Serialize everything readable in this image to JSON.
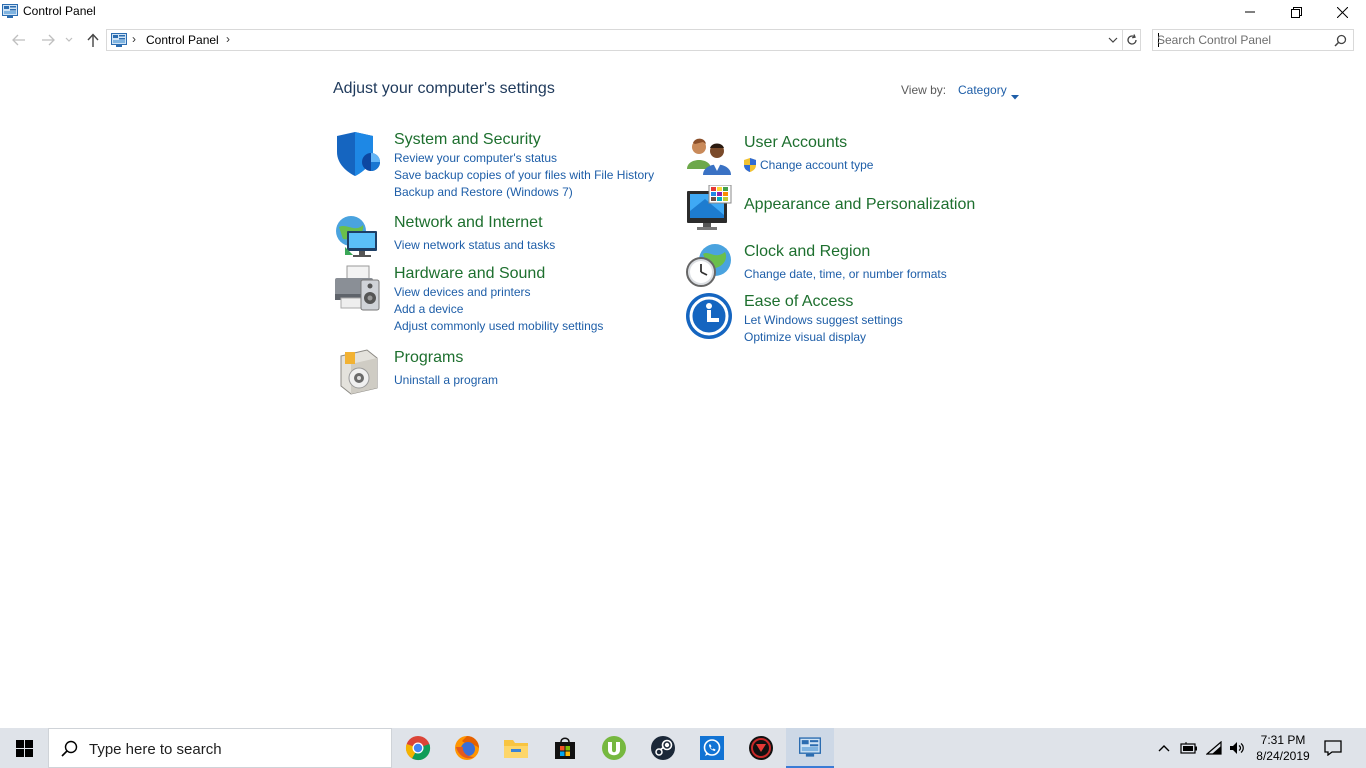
{
  "window": {
    "title": "Control Panel"
  },
  "address": {
    "crumb": "Control Panel",
    "search_placeholder": "Search Control Panel"
  },
  "content": {
    "heading": "Adjust your computer's settings",
    "view_by_label": "View by:",
    "view_by_value": "Category",
    "left_categories": [
      {
        "title": "System and Security",
        "icon": "shield-icon",
        "links": [
          "Review your computer's status",
          "Save backup copies of your files with File History",
          "Backup and Restore (Windows 7)"
        ]
      },
      {
        "title": "Network and Internet",
        "icon": "network-icon",
        "links": [
          "View network status and tasks"
        ]
      },
      {
        "title": "Hardware and Sound",
        "icon": "printer-speaker-icon",
        "links": [
          "View devices and printers",
          "Add a device",
          "Adjust commonly used mobility settings"
        ]
      },
      {
        "title": "Programs",
        "icon": "programs-disc-icon",
        "links": [
          "Uninstall a program"
        ]
      }
    ],
    "right_categories": [
      {
        "title": "User Accounts",
        "icon": "users-icon",
        "links": [
          "Change account type"
        ]
      },
      {
        "title": "Appearance and Personalization",
        "icon": "monitor-palette-icon",
        "links": []
      },
      {
        "title": "Clock and Region",
        "icon": "clock-globe-icon",
        "links": [
          "Change date, time, or number formats"
        ]
      },
      {
        "title": "Ease of Access",
        "icon": "ease-of-access-icon",
        "links": [
          "Let Windows suggest settings",
          "Optimize visual display"
        ]
      }
    ]
  },
  "taskbar": {
    "search_text": "Type here to search",
    "apps": [
      "chrome-icon",
      "firefox-icon",
      "file-explorer-icon",
      "store-icon",
      "utorrent-icon",
      "steam-icon",
      "whatsapp-icon",
      "game-app-icon",
      "control-panel-icon"
    ],
    "time": "7:31 PM",
    "date": "8/24/2019"
  },
  "colors": {
    "category_title": "#1d6f2e",
    "link": "#1e5ea8",
    "heading": "#1e395b",
    "taskbar": "#dfe3e9"
  }
}
